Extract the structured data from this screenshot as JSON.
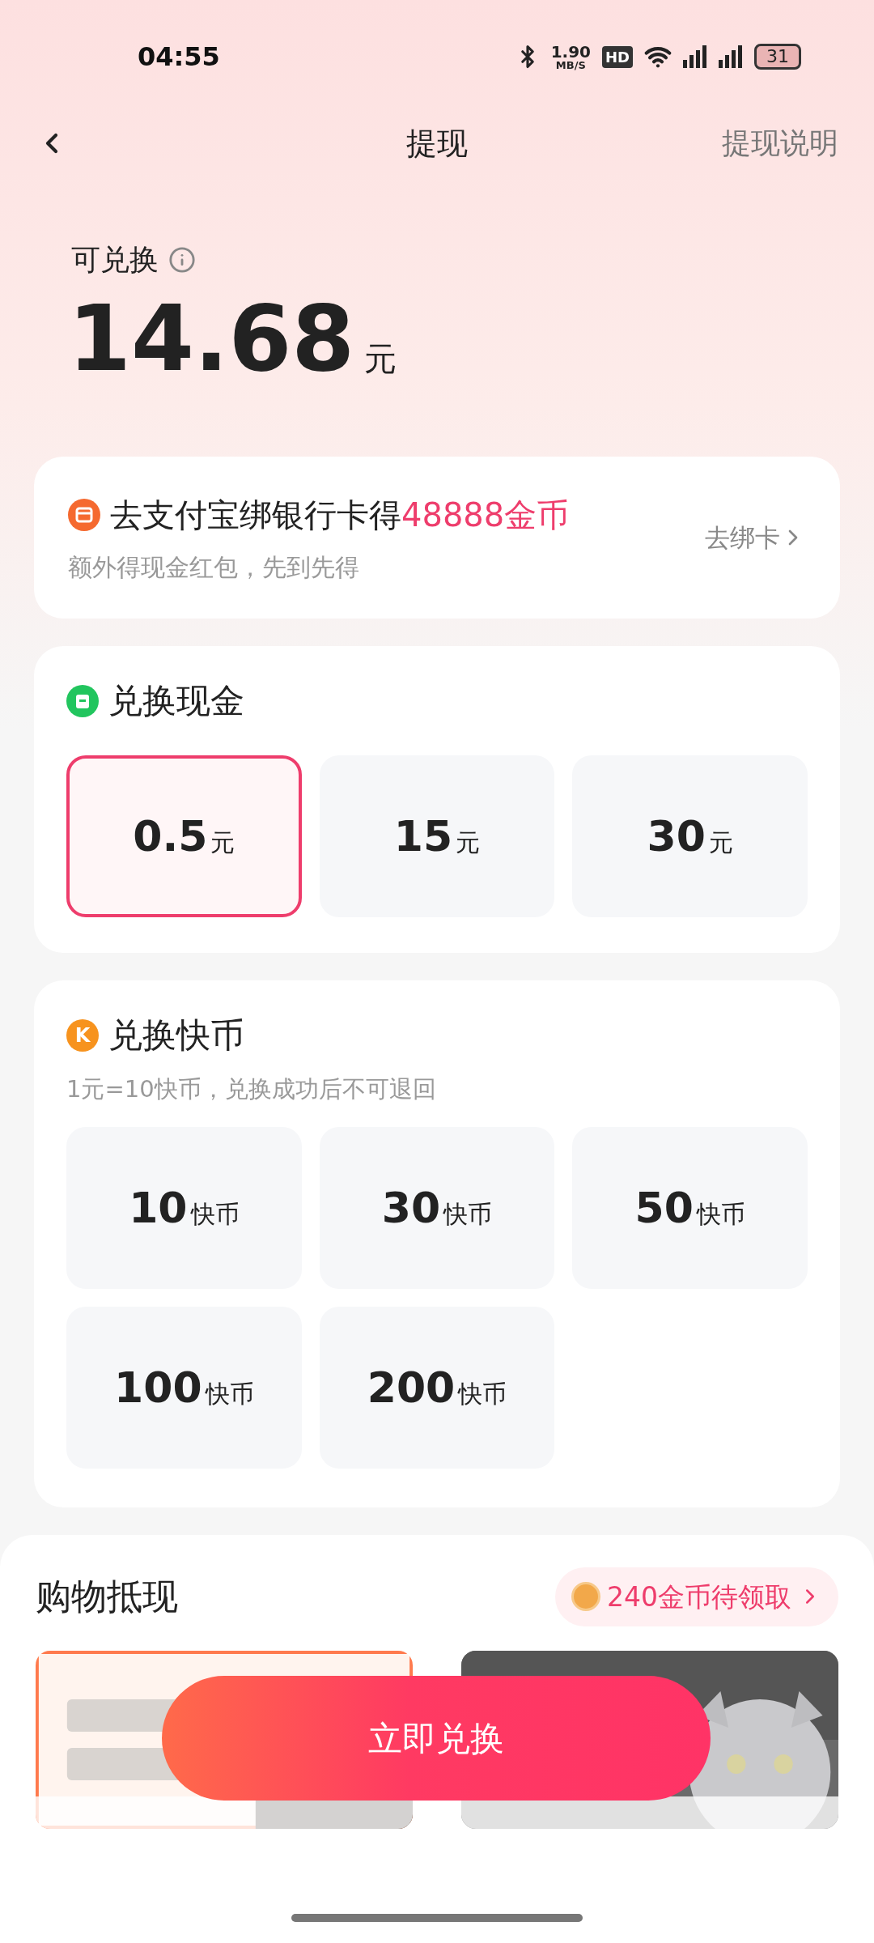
{
  "status_bar": {
    "time": "04:55",
    "speed": "1.90",
    "speed_unit": "MB/S",
    "hd": "HD",
    "battery": "31"
  },
  "header": {
    "title": "提现",
    "action": "提现说明"
  },
  "balance": {
    "label": "可兑换",
    "amount": "14.68",
    "unit": "元"
  },
  "promo": {
    "title": "去支付宝绑银行卡得**48888金币**",
    "subtitle": "额外得现金红包，先到先得",
    "action": "去绑卡"
  },
  "cash": {
    "title": "兑换现金",
    "options": [
      {
        "amount": "0.5",
        "unit": "元",
        "selected": true
      },
      {
        "amount": "15",
        "unit": "元",
        "selected": false
      },
      {
        "amount": "30",
        "unit": "元",
        "selected": false
      }
    ]
  },
  "coins": {
    "badge": "K",
    "title": "兑换快币",
    "note": "1元=10快币，兑换成功后不可退回",
    "options": [
      {
        "amount": "10",
        "unit": "快币",
        "selected": false
      },
      {
        "amount": "30",
        "unit": "快币",
        "selected": false
      },
      {
        "amount": "50",
        "unit": "快币",
        "selected": false
      },
      {
        "amount": "100",
        "unit": "快币",
        "selected": false
      },
      {
        "amount": "200",
        "unit": "快币",
        "selected": false
      }
    ]
  },
  "shopping": {
    "title": "购物抵现",
    "reward": "240金币待领取"
  },
  "exchange_button": "立即兑换"
}
